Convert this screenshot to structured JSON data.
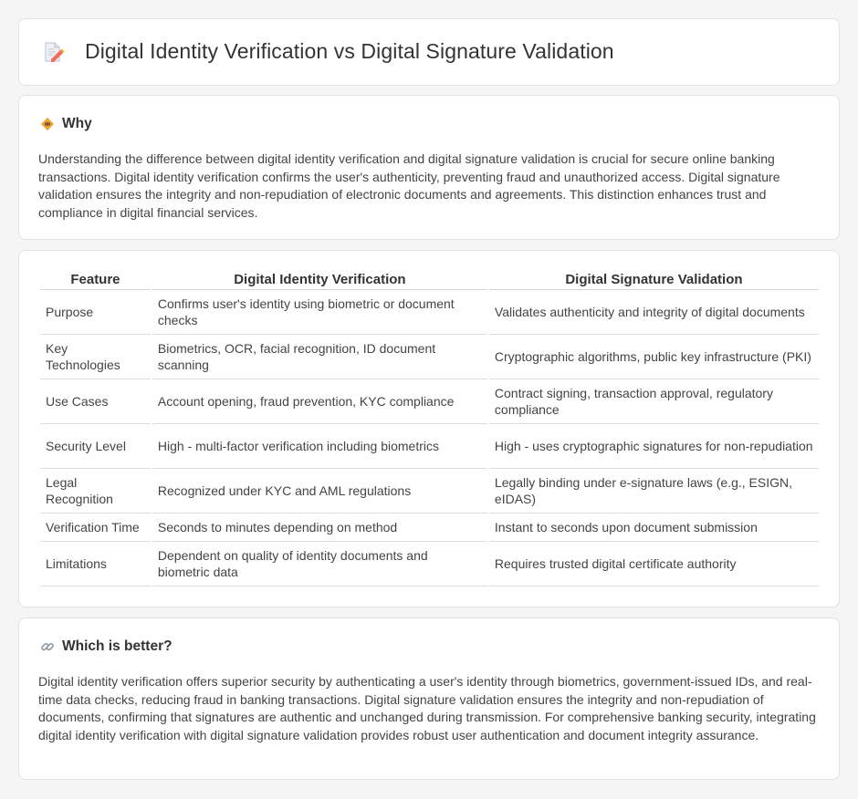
{
  "header": {
    "title": "Digital Identity Verification vs Digital Signature Validation",
    "icon": "document-pen-icon"
  },
  "why": {
    "title": "Why",
    "icon": "diamond-sign-icon",
    "text": "Understanding the difference between digital identity verification and digital signature validation is crucial for secure online banking transactions. Digital identity verification confirms the user's authenticity, preventing fraud and unauthorized access. Digital signature validation ensures the integrity and non-repudiation of electronic documents and agreements. This distinction enhances trust and compliance in digital financial services."
  },
  "table": {
    "headers": [
      "Feature",
      "Digital Identity Verification",
      "Digital Signature Validation"
    ],
    "rows": [
      [
        "Purpose",
        "Confirms user's identity using biometric or document checks",
        "Validates authenticity and integrity of digital documents"
      ],
      [
        "Key Technologies",
        "Biometrics, OCR, facial recognition, ID document scanning",
        "Cryptographic algorithms, public key infrastructure (PKI)"
      ],
      [
        "Use Cases",
        "Account opening, fraud prevention, KYC compliance",
        "Contract signing, transaction approval, regulatory compliance"
      ],
      [
        "Security Level",
        "High - multi-factor verification including biometrics",
        "High - uses cryptographic signatures for non-repudiation"
      ],
      [
        "Legal Recognition",
        "Recognized under KYC and AML regulations",
        "Legally binding under e-signature laws (e.g., ESIGN, eIDAS)"
      ],
      [
        "Verification Time",
        "Seconds to minutes depending on method",
        "Instant to seconds upon document submission"
      ],
      [
        "Limitations",
        "Dependent on quality of identity documents and biometric data",
        "Requires trusted digital certificate authority"
      ]
    ]
  },
  "better": {
    "title": "Which is better?",
    "icon": "link-icon",
    "text": "Digital identity verification offers superior security by authenticating a user's identity through biometrics, government-issued IDs, and real-time data checks, reducing fraud in banking transactions. Digital signature validation ensures the integrity and non-repudiation of documents, confirming that signatures are authentic and unchanged during transmission. For comprehensive banking security, integrating digital identity verification with digital signature validation provides robust user authentication and document integrity assurance."
  },
  "colors": {
    "background": "#f5f5f5",
    "card": "#ffffff",
    "border": "#e2e2e2",
    "accent": "#f0a43c"
  }
}
